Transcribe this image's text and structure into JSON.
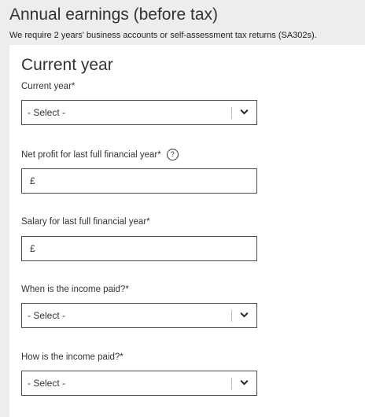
{
  "header": {
    "title": "Annual earnings (before tax)",
    "subtitle": "We require 2 years' business accounts or self-assessment tax returns (SA302s)."
  },
  "section": {
    "title": "Current year",
    "fields": {
      "current_year": {
        "label": "Current year*",
        "selected_value": "- Select -"
      },
      "net_profit": {
        "label": "Net profit for last full financial year*",
        "help_icon_glyph": "?",
        "currency_symbol": "£",
        "value": ""
      },
      "salary": {
        "label": "Salary for last full financial year*",
        "currency_symbol": "£",
        "value": ""
      },
      "income_paid_when": {
        "label": "When is the income paid?*",
        "selected_value": "- Select -"
      },
      "income_paid_how": {
        "label": "How is the income paid?*",
        "selected_value": "- Select -"
      }
    }
  },
  "icons": {
    "help": "help-circle-icon",
    "dropdown": "chevron-down-icon"
  },
  "colors": {
    "page_background": "#ededed",
    "panel_background": "#ffffff",
    "text": "#333333",
    "border": "#4d4d4d"
  }
}
